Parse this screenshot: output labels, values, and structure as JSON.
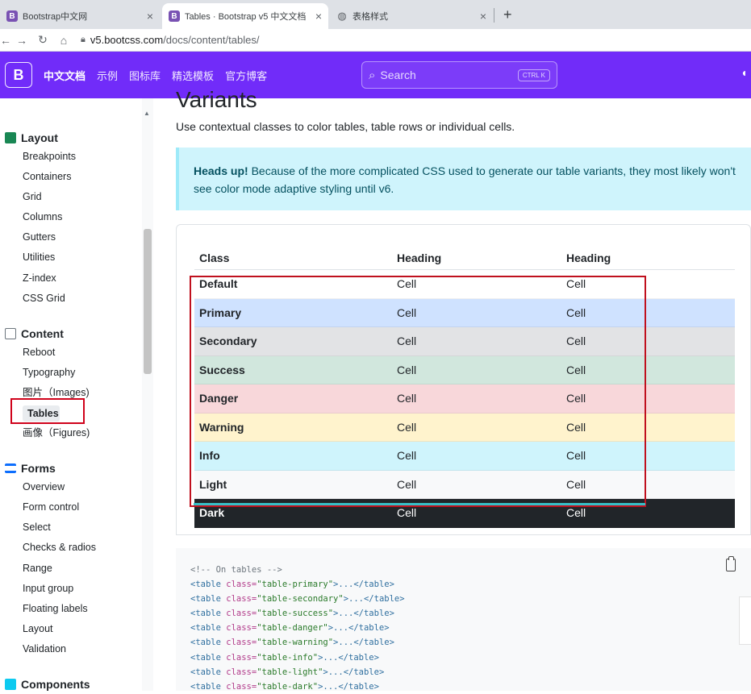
{
  "browser": {
    "tabs": [
      {
        "title": "Bootstrap中文网",
        "favicon": "B",
        "active": false
      },
      {
        "title": "Tables · Bootstrap v5 中文文档",
        "favicon": "B",
        "active": true
      },
      {
        "title": "表格样式",
        "favicon": "globe-icon",
        "active": false
      }
    ],
    "new_tab": "+",
    "close": "×",
    "url_host": "v5.bootcss.com",
    "url_path": "/docs/content/tables/"
  },
  "navbar": {
    "brand": "B",
    "links": [
      "中文文档",
      "示例",
      "图标库",
      "精选模板",
      "官方博客"
    ],
    "search_placeholder": "Search",
    "search_kbd": "CTRL K",
    "color": "#712cf9"
  },
  "sidebar": {
    "groups": [
      {
        "title": "Layout",
        "icon": "grid-icon",
        "color": "#198754",
        "items": [
          "Breakpoints",
          "Containers",
          "Grid",
          "Columns",
          "Gutters",
          "Utilities",
          "Z-index",
          "CSS Grid"
        ]
      },
      {
        "title": "Content",
        "icon": "file-icon",
        "color": "#6c757d",
        "items": [
          "Reboot",
          "Typography",
          "图片（Images)",
          "Tables",
          "画像（Figures)"
        ],
        "active": "Tables"
      },
      {
        "title": "Forms",
        "icon": "list-icon",
        "color": "#0d6efd",
        "items": [
          "Overview",
          "Form control",
          "Select",
          "Checks & radios",
          "Range",
          "Input group",
          "Floating labels",
          "Layout",
          "Validation"
        ]
      },
      {
        "title": "Components",
        "icon": "stack-icon",
        "color": "#0dcaf0",
        "items": []
      }
    ]
  },
  "main": {
    "heading": "Variants",
    "lead": "Use contextual classes to color tables, table rows or individual cells.",
    "callout_bold": "Heads up!",
    "callout_text": " Because of the more complicated CSS used to generate our table variants, they most likely won't see color mode adaptive styling until v6.",
    "table": {
      "headers": [
        "Class",
        "Heading",
        "Heading"
      ],
      "rows": [
        {
          "name": "Default",
          "c1": "Cell",
          "c2": "Cell",
          "bg": "#ffffff",
          "fg": "#212529"
        },
        {
          "name": "Primary",
          "c1": "Cell",
          "c2": "Cell",
          "bg": "#cfe2ff",
          "fg": "#212529"
        },
        {
          "name": "Secondary",
          "c1": "Cell",
          "c2": "Cell",
          "bg": "#e2e3e5",
          "fg": "#212529"
        },
        {
          "name": "Success",
          "c1": "Cell",
          "c2": "Cell",
          "bg": "#d1e7dd",
          "fg": "#212529"
        },
        {
          "name": "Danger",
          "c1": "Cell",
          "c2": "Cell",
          "bg": "#f8d7da",
          "fg": "#212529"
        },
        {
          "name": "Warning",
          "c1": "Cell",
          "c2": "Cell",
          "bg": "#fff3cd",
          "fg": "#212529"
        },
        {
          "name": "Info",
          "c1": "Cell",
          "c2": "Cell",
          "bg": "#cff4fc",
          "fg": "#212529"
        },
        {
          "name": "Light",
          "c1": "Cell",
          "c2": "Cell",
          "bg": "#f8f9fa",
          "fg": "#212529"
        },
        {
          "name": "Dark",
          "c1": "Cell",
          "c2": "Cell",
          "bg": "#212529",
          "fg": "#ffffff"
        }
      ]
    },
    "code": {
      "comment": "<!-- On tables -->",
      "lines": [
        {
          "cls": "table-primary"
        },
        {
          "cls": "table-secondary"
        },
        {
          "cls": "table-success"
        },
        {
          "cls": "table-danger"
        },
        {
          "cls": "table-warning"
        },
        {
          "cls": "table-info"
        },
        {
          "cls": "table-light"
        },
        {
          "cls": "table-dark"
        }
      ]
    }
  }
}
